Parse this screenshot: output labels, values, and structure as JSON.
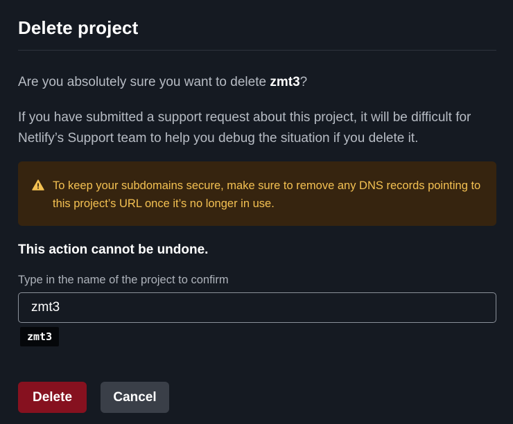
{
  "dialog": {
    "title": "Delete project",
    "question_prefix": "Are you absolutely sure you want to delete ",
    "project_name": "zmt3",
    "question_suffix": "?",
    "paragraph": "If you have submitted a support request about this project, it will be difficult for Netlify’s Support team to help you debug the situation if you delete it.",
    "warning": {
      "icon": "warning-triangle-icon",
      "text": "To keep your subdomains secure, make sure to remove any DNS records pointing to this project’s URL once it’s no longer in use."
    },
    "cannot_undo": "This action cannot be undone.",
    "confirm": {
      "label": "Type in the name of the project to confirm",
      "value": "zmt3",
      "hint": "zmt3"
    },
    "buttons": {
      "delete": "Delete",
      "cancel": "Cancel"
    }
  },
  "colors": {
    "background": "#151a22",
    "warning_bg": "#36240f",
    "warning_text": "#f4c152",
    "delete_button": "#86111f",
    "cancel_button": "#3a3f48"
  }
}
